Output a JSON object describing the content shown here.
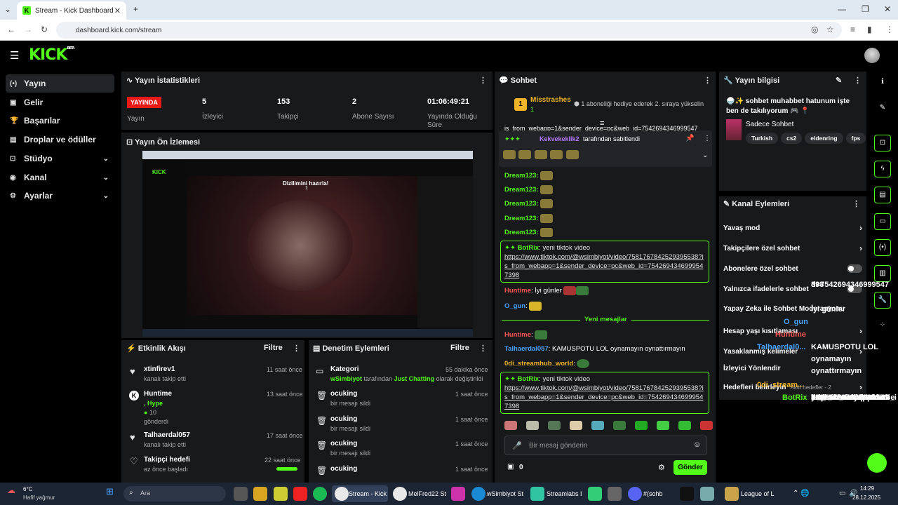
{
  "browser": {
    "tab_title": "Stream - Kick Dashboard",
    "url": "dashboard.kick.com/stream"
  },
  "brand": {
    "logo": "KICK",
    "beta": "BETA",
    "accent": "#53fc18"
  },
  "sidebar": {
    "items": [
      {
        "label": "Yayın",
        "icon": "broadcast-icon",
        "active": true
      },
      {
        "label": "Gelir",
        "icon": "money-icon"
      },
      {
        "label": "Başarılar",
        "icon": "trophy-icon"
      },
      {
        "label": "Droplar ve ödüller",
        "icon": "gift-icon"
      },
      {
        "label": "Stüdyo",
        "icon": "studio-icon",
        "chevron": true
      },
      {
        "label": "Kanal",
        "icon": "channel-icon",
        "chevron": true
      },
      {
        "label": "Ayarlar",
        "icon": "gear-icon",
        "chevron": true
      }
    ]
  },
  "stats": {
    "title": "Yayın İstatistikleri",
    "live": "YAYINDA",
    "live_label": "Yayın",
    "items": [
      {
        "value": "5",
        "label": "İzleyici"
      },
      {
        "value": "153",
        "label": "Takipçi"
      },
      {
        "value": "2",
        "label": "Abone Sayısı"
      },
      {
        "value": "01:06:49:21",
        "label": "Yayında Olduğu Süre"
      }
    ]
  },
  "preview": {
    "title": "Yayın Ön İzlemesi",
    "overlay_title": "Dizilimini hazırla!",
    "overlay_num": "1"
  },
  "activity": {
    "title": "Etkinlik Akışı",
    "filter": "Filtre",
    "items": [
      {
        "name": "xtinfirev1",
        "sub": "kanalı takip etti",
        "time": "11 saat önce"
      },
      {
        "name": "Huntime",
        "sub2": ", Hype",
        "count": "10",
        "sub": "gönderdi",
        "time": "13 saat önce"
      },
      {
        "name": "Talhaerdal057",
        "sub": "kanalı takip etti",
        "time": "17 saat önce"
      },
      {
        "name": "Takipçi hedefi",
        "sub": "az önce başladı",
        "time": "22 saat önce"
      }
    ]
  },
  "moderation": {
    "title": "Denetim Eylemleri",
    "filter": "Filtre",
    "items": [
      {
        "name": "Kategori",
        "user": "wSimbiyot",
        "mid": "tarafından",
        "cat": "Just Chatting",
        "tail": "olarak değiştirildi",
        "time": "55 dakika önce"
      },
      {
        "name": "ocuking",
        "sub": "bir mesajı sildi",
        "time": "1 saat önce"
      },
      {
        "name": "ocuking",
        "sub": "bir mesajı sildi",
        "time": "1 saat önce"
      },
      {
        "name": "ocuking",
        "sub": "bir mesajı sildi",
        "time": "1 saat önce"
      },
      {
        "name": "ocuking",
        "sub": "bir mesajı sildi",
        "time": "1 saat önce"
      }
    ]
  },
  "chat": {
    "title": "Sohbet",
    "top_user": "Misstrashes",
    "top_count": "1",
    "top_badge_num": "1",
    "gift_text": "1 aboneliği hediye ederek 2. sıraya yükselin",
    "partial": "is_from_webapp=1&sender_device=pc&web_id=7542694346999547",
    "pinned_by": "Kekvekeklik2",
    "pinned_tail": "tarafından sabitlendi",
    "dream_user": "Dream123:",
    "bot_user": "BotRix",
    "bot_text": ": yeni tiktok video",
    "link": "https://www.tiktok.com/@wsimbiyot/video/7581767842529395538?is_from_webapp=1&sender_device=pc&web_id=7542694346999547398",
    "m1_user": "Huntime",
    "m1_text": ": İyi günler",
    "m2_user": "O_gun",
    "new_messages": "Yeni mesajlar",
    "m3_user": "Huntime",
    "m4_user": "Talhaerdal057",
    "m4_text": ": KAMUSPOTU LOL oynamayın oynattırmayın",
    "m5_user": "0di_streamhub_world",
    "placeholder": "Bir mesaj gönderin",
    "points": "0",
    "send": "Gönder"
  },
  "info": {
    "title": "Yayın bilgisi",
    "stream_title": "🍚✨ sohbet muhabbet hatunum işte ben de takılıyorum 🎮 📍",
    "category": "Sadece Sohbet",
    "tags": [
      "Turkish",
      "cs2",
      "eldenring",
      "fps"
    ]
  },
  "actions": {
    "title": "Kanal Eylemleri",
    "rows": [
      {
        "label": "Yavaş mod",
        "kind": "chevron"
      },
      {
        "label": "Takipçilere özel sohbet",
        "kind": "chevron"
      },
      {
        "label": "Abonelere özel sohbet",
        "kind": "toggle"
      },
      {
        "label": "Yalnızca ifadelerle sohbet",
        "kind": "toggle"
      },
      {
        "label": "Yapay Zeka ile Sohbet Moderasyonu",
        "kind": "chevron"
      },
      {
        "label": "Hesap yaşı kısıtlaması",
        "kind": "chevron"
      },
      {
        "label": "Yasaklanmış kelimeler",
        "kind": "chevron"
      },
      {
        "label": "İzleyici Yönlendir",
        "kind": "none"
      },
      {
        "label": "Hedefleri belirleyin",
        "extra": "Aktif hedefler - 2",
        "kind": "chevron"
      }
    ]
  },
  "overlay": {
    "lines": [
      "d=7542694346999547",
      "398",
      "İyi günler",
      "O_gun",
      "Huntime",
      "Talhaerdal0...",
      "KAMUSPOTU LOL",
      "oynamayın",
      "oynattırmayın",
      "0di_stream...",
      "BotRix",
      "yeni tiktok video",
      "https://www.tiktok.co",
      "m/@wsimbiyot/video/",
      "758176784252939553",
      "8?",
      "is_from_webapp=1&se",
      "nder_device=pc&web_i",
      "d=7542694346999547",
      "398"
    ]
  },
  "taskbar": {
    "weather_temp": "6°C",
    "weather_text": "Hafif yağmur",
    "search": "Ara",
    "time": "14:29",
    "date": "28.12.2025",
    "apps": [
      "Stream - Kick",
      "MelFred22 St",
      "wSimbiyot St",
      "Streamlabs I",
      "#(sohb",
      "League of L"
    ]
  }
}
